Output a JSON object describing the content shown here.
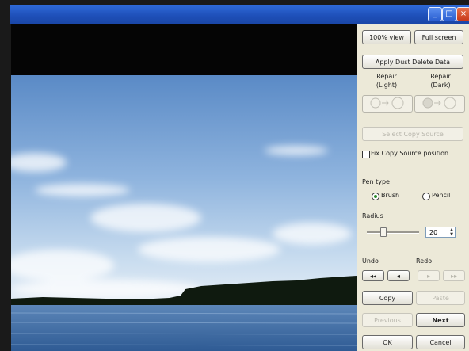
{
  "window": {
    "minimize_glyph": "_",
    "maximize_glyph": "□",
    "close_glyph": "×"
  },
  "panel": {
    "btn_100": "100% view",
    "btn_full": "Full screen",
    "btn_apply": "Apply Dust Delete Data",
    "repair_light": "Repair\n(Light)",
    "repair_dark": "Repair\n(Dark)",
    "select_copy_source": "Select Copy Source",
    "fix_copy_source": "Fix Copy Source position",
    "pen_type": "Pen type",
    "brush": "Brush",
    "pencil": "Pencil",
    "radius": "Radius",
    "radius_value": "20",
    "undo": "Undo",
    "redo": "Redo",
    "undo_all": "◂◂",
    "undo_one": "◂",
    "redo_one": "▸",
    "redo_all": "▸▸",
    "copy": "Copy",
    "paste": "Paste",
    "previous": "Previous",
    "next": "Next",
    "ok": "OK",
    "cancel": "Cancel"
  },
  "colors": {
    "title_bar": "#2f6ad8",
    "panel_bg": "#ece9d8",
    "sky_top": "#5d8cc6",
    "water": "#4a74a8"
  }
}
